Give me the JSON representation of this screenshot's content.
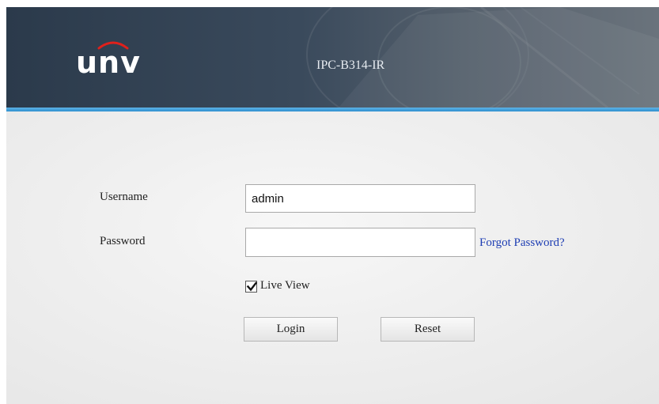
{
  "header": {
    "brand": "UNV",
    "model": "IPC-B314-IR"
  },
  "login_form": {
    "username_label": "Username",
    "username_value": "admin",
    "password_label": "Password",
    "password_value": "",
    "forgot_password_link": "Forgot Password?",
    "live_view_label": "Live View",
    "live_view_checked": true,
    "login_button": "Login",
    "reset_button": "Reset"
  },
  "colors": {
    "header_bg": "#2b3a4b",
    "accent_line": "#2e8fd0",
    "logo_arc": "#e0201b",
    "link": "#1d3db3"
  },
  "icons": {
    "brand_logo": "unv-logo",
    "checkbox": "check-icon"
  }
}
